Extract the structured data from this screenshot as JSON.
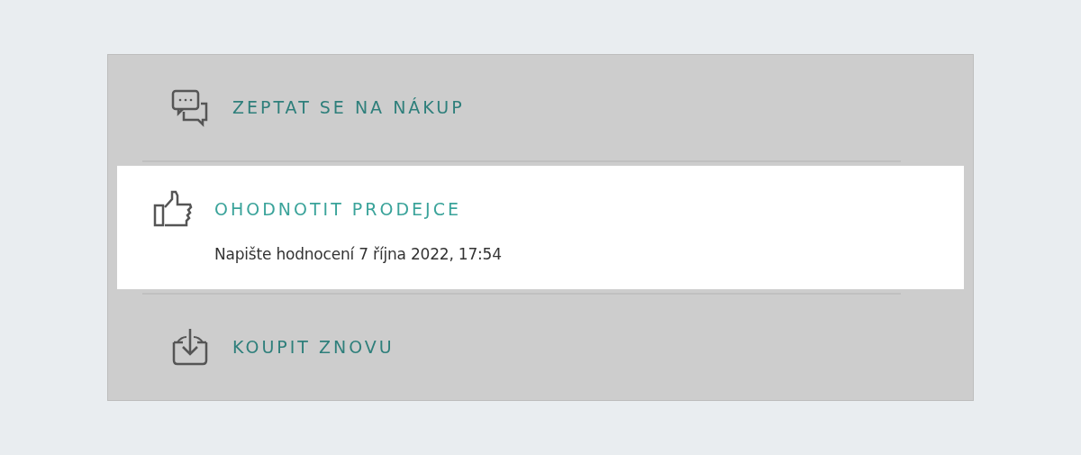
{
  "actions": [
    {
      "kind": "ask",
      "label": "ZEPTAT SE NA NÁKUP",
      "selected": false
    },
    {
      "kind": "rate",
      "label": "OHODNOTIT PRODEJCE",
      "selected": true,
      "detail": "Napište hodnocení 7 října 2022, 17:54"
    },
    {
      "kind": "rebuy",
      "label": "KOUPIT ZNOVU",
      "selected": false
    }
  ]
}
